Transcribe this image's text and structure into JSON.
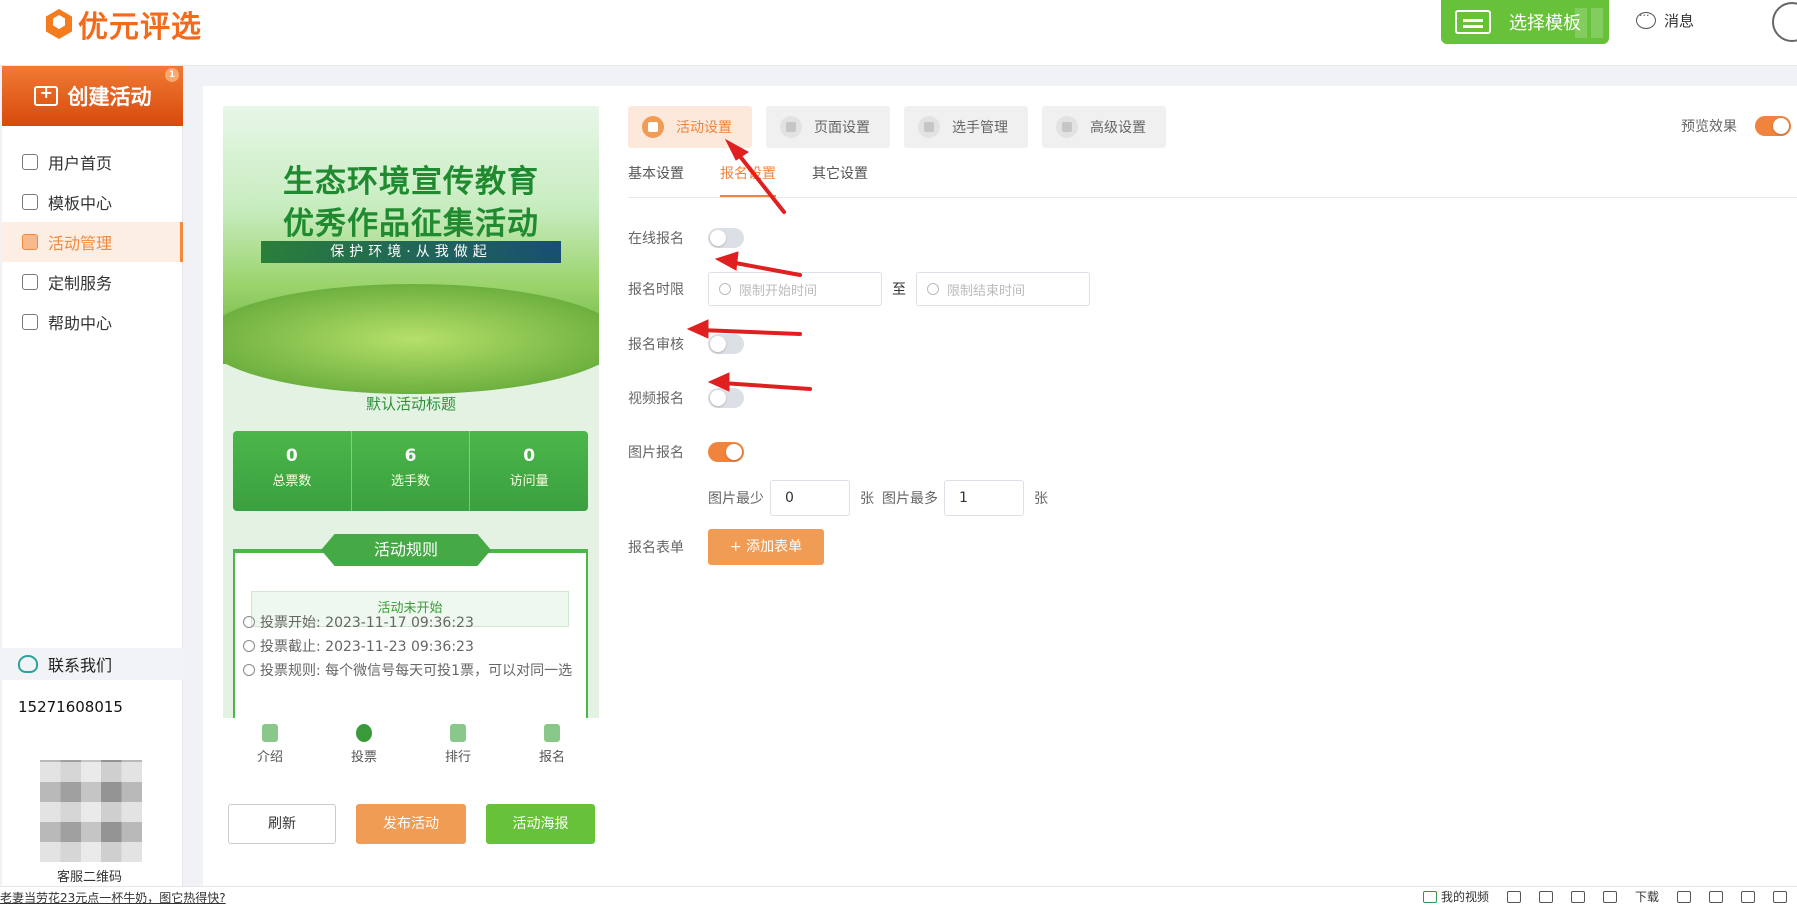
{
  "header": {
    "logo_text": "优元评选",
    "template_button": "选择模板",
    "message_label": "消息"
  },
  "sidebar": {
    "create_label": "创建活动",
    "badge": "1",
    "items": [
      {
        "label": "用户首页",
        "icon": "home-icon",
        "active": false
      },
      {
        "label": "模板中心",
        "icon": "folder-icon",
        "active": false
      },
      {
        "label": "活动管理",
        "icon": "ticket-icon",
        "active": true
      },
      {
        "label": "定制服务",
        "icon": "tools-icon",
        "active": false
      },
      {
        "label": "帮助中心",
        "icon": "help-icon",
        "active": false
      }
    ],
    "contact_label": "联系我们",
    "phone": "15271608015",
    "qr_label": "客服二维码"
  },
  "preview": {
    "banner_line1": "生态环境宣传教育",
    "banner_line2": "优秀作品征集活动",
    "banner_slogan": "保护环境·从我做起",
    "activity_title": "默认活动标题",
    "stats": [
      {
        "value": "0",
        "label": "总票数"
      },
      {
        "value": "6",
        "label": "选手数"
      },
      {
        "value": "0",
        "label": "访问量"
      }
    ],
    "rules_title": "活动规则",
    "status": "活动未开始",
    "vote_start_label": "投票开始:",
    "vote_start": "2023-11-17 09:36:23",
    "vote_end_label": "投票截止:",
    "vote_end": "2023-11-23 09:36:23",
    "vote_rule": "投票规则: 每个微信号每天可投1票，可以对同一选",
    "tabs": [
      "介绍",
      "投票",
      "排行",
      "报名"
    ],
    "refresh": "刷新",
    "publish": "发布活动",
    "poster": "活动海报"
  },
  "settings": {
    "top_tabs": [
      "活动设置",
      "页面设置",
      "选手管理",
      "高级设置"
    ],
    "preview_effect": "预览效果",
    "sub_tabs": [
      "基本设置",
      "报名设置",
      "其它设置"
    ],
    "online_signup": "在线报名",
    "signup_period": "报名时限",
    "start_placeholder": "限制开始时间",
    "to": "至",
    "end_placeholder": "限制结束时间",
    "signup_review": "报名审核",
    "video_signup": "视频报名",
    "image_signup": "图片报名",
    "img_min_label": "图片最少",
    "img_min": "0",
    "unit1": "张",
    "img_max_label": "图片最多",
    "img_max": "1",
    "unit2": "张",
    "signup_form": "报名表单",
    "add_form": "+ 添加表单",
    "toggles": {
      "online": false,
      "review": false,
      "video": false,
      "image": true,
      "preview": true
    }
  },
  "statusbar": {
    "news": "老妻当劳花23元点一杯牛奶，图它热得快?",
    "my_video": "我的视频",
    "download": "下载"
  },
  "colors": {
    "accent": "#f0843c",
    "green": "#67c23a",
    "arrow": "#e02020"
  }
}
